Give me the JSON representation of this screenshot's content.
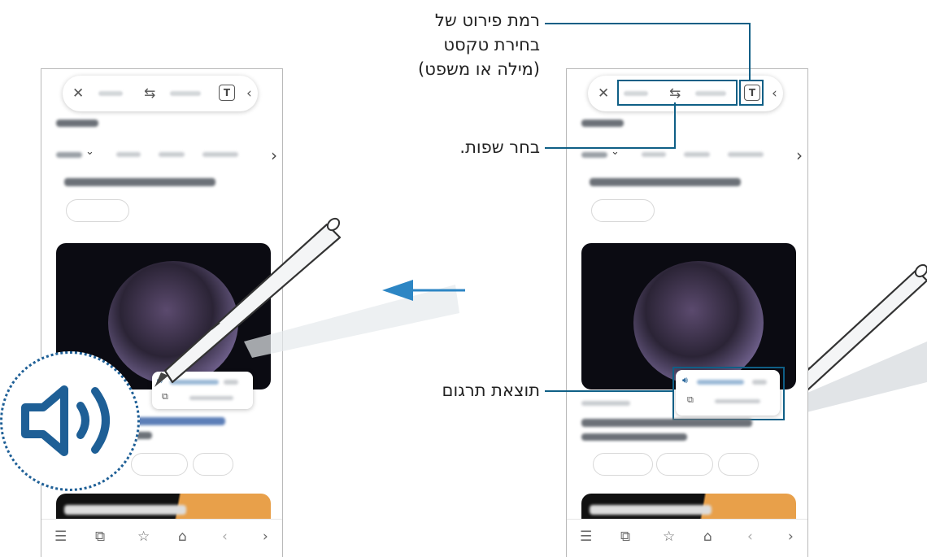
{
  "toolbar": {
    "close_icon": "✕",
    "swap_icon": "⇆",
    "text_mode_icon": "T",
    "back_icon": "‹"
  },
  "navbar": {
    "menu_icon": "☰",
    "tabs_icon": "⧉",
    "bookmark_icon": "☆",
    "home_icon": "⌂",
    "back_icon": "‹",
    "forward_icon": "›"
  },
  "scroll_right_icon": "›",
  "callouts": {
    "text_level": [
      "רמת פירוט של",
      "בחירת טקסט",
      "(מילה או משפט)"
    ],
    "select_languages": "בחר שפות.",
    "translation_result": "תוצאת תרגום"
  },
  "colors": {
    "accent": "#0f5f86",
    "arrow": "#2d86c4",
    "speaker": "#1e5f96"
  }
}
